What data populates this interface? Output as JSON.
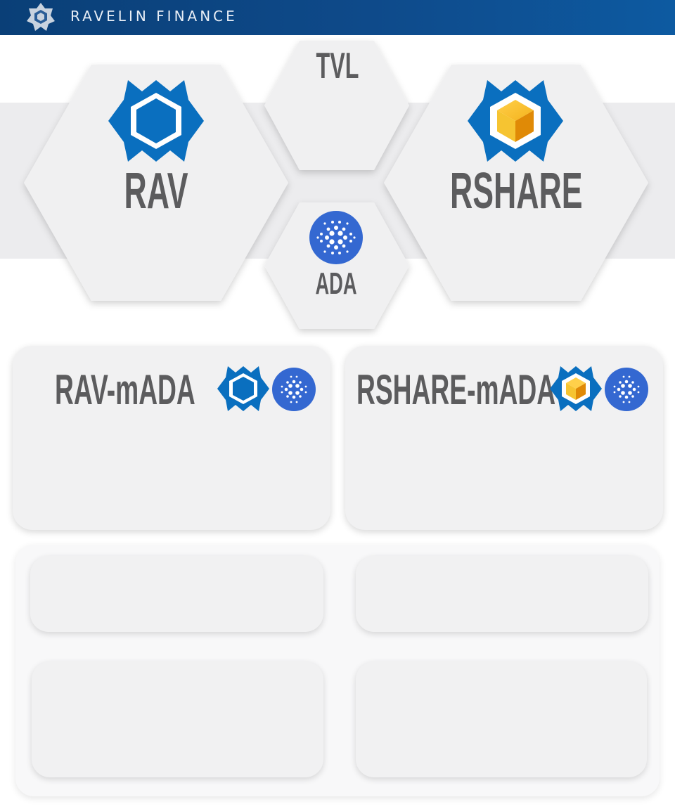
{
  "header": {
    "brand_name": "RAVELIN FINANCE",
    "logo_icon": "ravelin-logo-icon"
  },
  "tokens": {
    "rav": {
      "label": "RAV",
      "icon": "rav-token-icon"
    },
    "tvl": {
      "label": "TVL"
    },
    "rshare": {
      "label": "RSHARE",
      "icon": "rshare-token-icon"
    },
    "ada": {
      "label": "ADA",
      "icon": "ada-token-icon"
    }
  },
  "pairs": [
    {
      "label": "RAV-mADA",
      "icons": [
        "rav-token-icon",
        "ada-token-icon"
      ]
    },
    {
      "label": "RSHARE-mADA",
      "icons": [
        "rshare-token-icon",
        "ada-token-icon"
      ]
    }
  ],
  "colors": {
    "brand_blue": "#0a6fbf",
    "rshare_gold": "#f2b01e",
    "ada_blue": "#3468d1",
    "header_bg": "#0e4a8a",
    "card_bg": "#f1f1f2",
    "label_gray": "#5c5c5e"
  }
}
